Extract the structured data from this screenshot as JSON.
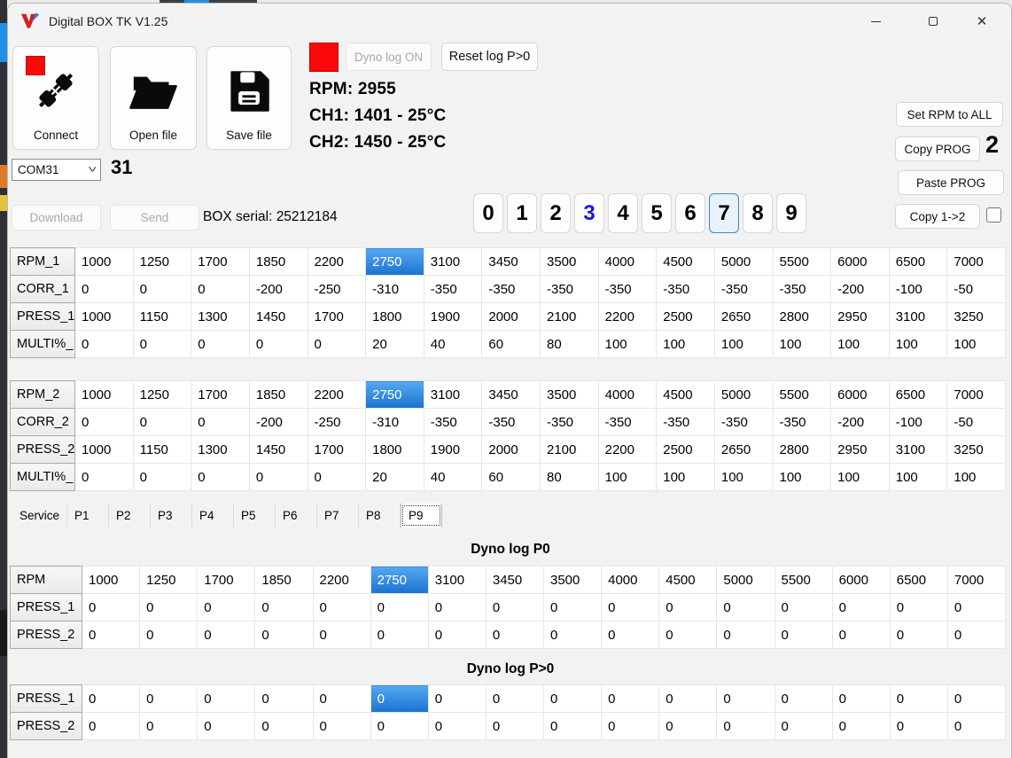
{
  "window": {
    "title": "Digital BOX TK V1.25"
  },
  "toolbar": {
    "connect_label": "Connect",
    "open_label": "Open file",
    "save_label": "Save file",
    "dyno_log_label": "Dyno log ON",
    "reset_log_label": "Reset log P>0"
  },
  "status": {
    "rpm": "RPM: 2955",
    "ch1": "CH1: 1401 - 25°C",
    "ch2": "CH2: 1450 - 25°C"
  },
  "comms": {
    "port": "COM31",
    "port_number": "31",
    "download_label": "Download",
    "send_label": "Send",
    "box_serial": "BOX serial: 25212184"
  },
  "prog": {
    "digits": [
      "0",
      "1",
      "2",
      "3",
      "4",
      "5",
      "6",
      "7",
      "8",
      "9"
    ],
    "active_digit": "7",
    "blue_digit": "3",
    "set_rpm_all": "Set RPM to ALL",
    "copy_prog": "Copy PROG",
    "copy_prog_value": "2",
    "paste_prog": "Paste PROG",
    "copy_12": "Copy 1->2",
    "copy_12_checked": false
  },
  "tables": {
    "prog1": {
      "rows": [
        {
          "label": "RPM_1",
          "selected": 5,
          "values": [
            1000,
            1250,
            1700,
            1850,
            2200,
            2750,
            3100,
            3450,
            3500,
            4000,
            4500,
            5000,
            5500,
            6000,
            6500,
            7000
          ]
        },
        {
          "label": "CORR_1",
          "values": [
            0,
            0,
            0,
            -200,
            -250,
            -310,
            -350,
            -350,
            -350,
            -350,
            -350,
            -350,
            -350,
            -200,
            -100,
            -50
          ]
        },
        {
          "label": "PRESS_1",
          "values": [
            1000,
            1150,
            1300,
            1450,
            1700,
            1800,
            1900,
            2000,
            2100,
            2200,
            2500,
            2650,
            2800,
            2950,
            3100,
            3250
          ]
        },
        {
          "label": "MULTI%_",
          "values": [
            0,
            0,
            0,
            0,
            0,
            20,
            40,
            60,
            80,
            100,
            100,
            100,
            100,
            100,
            100,
            100
          ]
        }
      ]
    },
    "prog2": {
      "rows": [
        {
          "label": "RPM_2",
          "selected": 5,
          "values": [
            1000,
            1250,
            1700,
            1850,
            2200,
            2750,
            3100,
            3450,
            3500,
            4000,
            4500,
            5000,
            5500,
            6000,
            6500,
            7000
          ]
        },
        {
          "label": "CORR_2",
          "values": [
            0,
            0,
            0,
            -200,
            -250,
            -310,
            -350,
            -350,
            -350,
            -350,
            -350,
            -350,
            -350,
            -200,
            -100,
            -50
          ]
        },
        {
          "label": "PRESS_2",
          "values": [
            1000,
            1150,
            1300,
            1450,
            1700,
            1800,
            1900,
            2000,
            2100,
            2200,
            2500,
            2650,
            2800,
            2950,
            3100,
            3250
          ]
        },
        {
          "label": "MULTI%_",
          "values": [
            0,
            0,
            0,
            0,
            0,
            20,
            40,
            60,
            80,
            100,
            100,
            100,
            100,
            100,
            100,
            100
          ]
        }
      ]
    },
    "dyno_p0": {
      "title": "Dyno log  P0",
      "rows": [
        {
          "label": "RPM",
          "selected": 5,
          "values": [
            1000,
            1250,
            1700,
            1850,
            2200,
            2750,
            3100,
            3450,
            3500,
            4000,
            4500,
            5000,
            5500,
            6000,
            6500,
            7000
          ]
        },
        {
          "label": "PRESS_1",
          "values": [
            0,
            0,
            0,
            0,
            0,
            0,
            0,
            0,
            0,
            0,
            0,
            0,
            0,
            0,
            0,
            0
          ]
        },
        {
          "label": "PRESS_2",
          "values": [
            0,
            0,
            0,
            0,
            0,
            0,
            0,
            0,
            0,
            0,
            0,
            0,
            0,
            0,
            0,
            0
          ]
        }
      ]
    },
    "dyno_pgt0": {
      "title": "Dyno log  P>0",
      "rows": [
        {
          "label": "PRESS_1",
          "selected": 5,
          "values": [
            0,
            0,
            0,
            0,
            0,
            0,
            0,
            0,
            0,
            0,
            0,
            0,
            0,
            0,
            0,
            0
          ]
        },
        {
          "label": "PRESS_2",
          "values": [
            0,
            0,
            0,
            0,
            0,
            0,
            0,
            0,
            0,
            0,
            0,
            0,
            0,
            0,
            0,
            0
          ]
        }
      ]
    }
  },
  "tabs": {
    "items": [
      "Service",
      "P1",
      "P2",
      "P3",
      "P4",
      "P5",
      "P6",
      "P7",
      "P8",
      "P9"
    ],
    "active": "P9"
  },
  "colors": {
    "selection_blue": "#1a73d0",
    "digit_blue": "#1414ee",
    "led_red": "#fb0808",
    "active_digit_bg": "#e7f2fc"
  }
}
